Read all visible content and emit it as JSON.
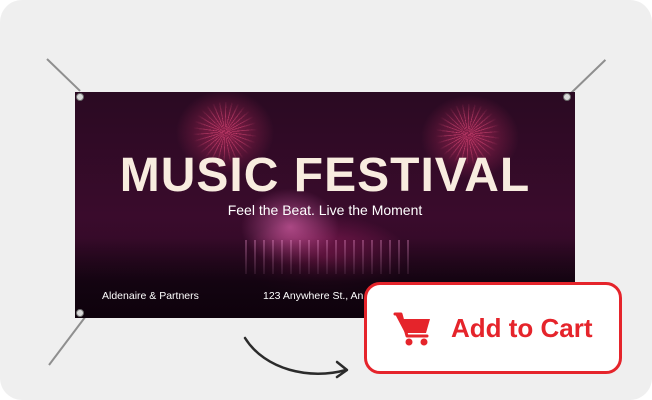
{
  "banner": {
    "title": "MUSIC FESTIVAL",
    "subtitle": "Feel the Beat. Live the Moment",
    "footer_left": "Aldenaire & Partners",
    "footer_right": "123 Anywhere St., An"
  },
  "cart_button": {
    "label": "Add to Cart",
    "icon": "shopping-cart-icon"
  },
  "colors": {
    "accent": "#e5242b",
    "background": "#efefef",
    "banner_text": "#f8ecdf"
  }
}
